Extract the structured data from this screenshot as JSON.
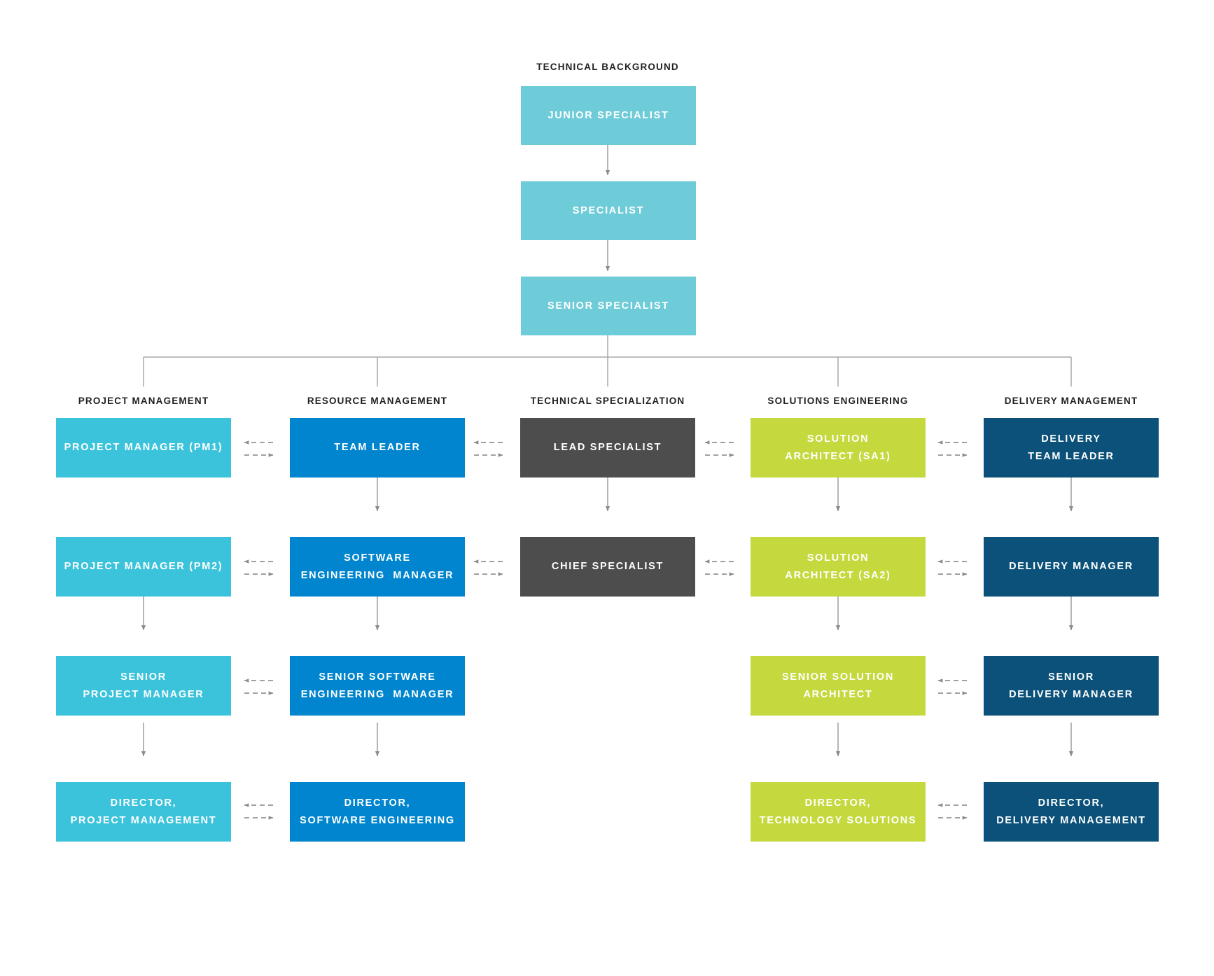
{
  "diagram": {
    "type": "org-career-path",
    "top_section": {
      "title": "TECHNICAL BACKGROUND",
      "color": "#6ecbd8",
      "boxes": [
        {
          "label": "JUNIOR SPECIALIST"
        },
        {
          "label": "SPECIALIST"
        },
        {
          "label": "SENIOR SPECIALIST"
        }
      ]
    },
    "columns": [
      {
        "title": "PROJECT MANAGEMENT",
        "color": "#3cc3dc",
        "boxes": [
          {
            "lines": [
              "PROJECT MANAGER (PM1)"
            ]
          },
          {
            "lines": [
              "PROJECT MANAGER (PM2)"
            ]
          },
          {
            "lines": [
              "SENIOR",
              "PROJECT MANAGER"
            ]
          },
          {
            "lines": [
              "DIRECTOR,",
              "PROJECT MANAGEMENT"
            ]
          }
        ]
      },
      {
        "title": "RESOURCE MANAGEMENT",
        "color": "#0085ce",
        "boxes": [
          {
            "lines": [
              "TEAM LEADER"
            ]
          },
          {
            "lines": [
              "SOFTWARE",
              "ENGINEERING  MANAGER"
            ]
          },
          {
            "lines": [
              "SENIOR SOFTWARE",
              "ENGINEERING  MANAGER"
            ]
          },
          {
            "lines": [
              "DIRECTOR,",
              "SOFTWARE ENGINEERING"
            ]
          }
        ]
      },
      {
        "title": "TECHNICAL SPECIALIZATION",
        "color": "#4d4d4d",
        "boxes": [
          {
            "lines": [
              "LEAD SPECIALIST"
            ]
          },
          {
            "lines": [
              "CHIEF SPECIALIST"
            ]
          },
          null,
          null
        ]
      },
      {
        "title": "SOLUTIONS ENGINEERING",
        "color": "#c5d93f",
        "boxes": [
          {
            "lines": [
              "SOLUTION",
              "ARCHITECT (SA1)"
            ]
          },
          {
            "lines": [
              "SOLUTION",
              "ARCHITECT (SA2)"
            ]
          },
          {
            "lines": [
              "SENIOR SOLUTION",
              "ARCHITECT"
            ]
          },
          {
            "lines": [
              "DIRECTOR,",
              "TECHNOLOGY SOLUTIONS"
            ]
          }
        ]
      },
      {
        "title": "DELIVERY MANAGEMENT",
        "color": "#0b5179",
        "boxes": [
          {
            "lines": [
              "DELIVERY",
              "TEAM LEADER"
            ]
          },
          {
            "lines": [
              "DELIVERY MANAGER"
            ]
          },
          {
            "lines": [
              "SENIOR",
              "DELIVERY MANAGER"
            ]
          },
          {
            "lines": [
              "DIRECTOR,",
              "DELIVERY MANAGEMENT"
            ]
          }
        ]
      }
    ],
    "connector_color": "#8c8c8c",
    "background": "#ffffff"
  }
}
